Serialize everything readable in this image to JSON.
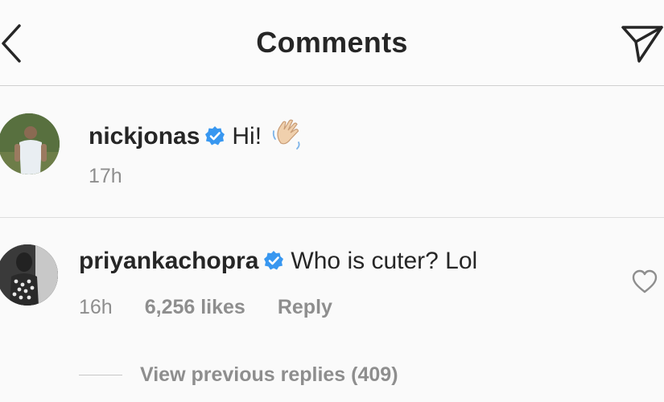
{
  "header": {
    "title": "Comments",
    "back_icon": "chevron-left-icon",
    "send_icon": "direct-send-icon"
  },
  "caption": {
    "username": "nickjonas",
    "verified": true,
    "text": "Hi!",
    "emoji": "waving-hand-icon",
    "time": "17h"
  },
  "comment": {
    "username": "priyankachopra",
    "verified": true,
    "text": "Who is cuter? Lol",
    "time": "16h",
    "likes": "6,256 likes",
    "reply_label": "Reply",
    "like_icon": "heart-outline-icon",
    "view_replies": "View previous replies (409)"
  },
  "colors": {
    "verified_blue": "#3897f0",
    "text_primary": "#262626",
    "text_secondary": "#8e8e8e",
    "background": "#fafafa"
  }
}
